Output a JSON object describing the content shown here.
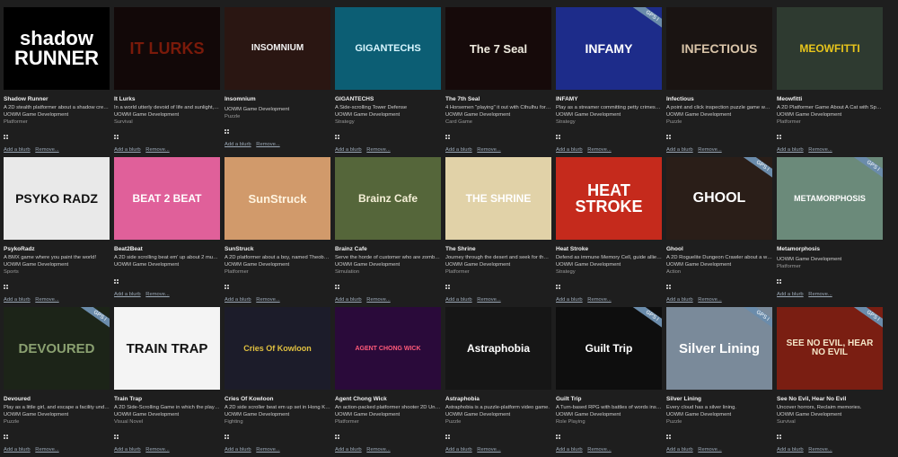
{
  "colors": {
    "background": "#1e1e1e",
    "action_link": "#9aa7b5",
    "ribbon": "#6b8cab"
  },
  "actions": {
    "add_blurb": "Add a blurb",
    "remove": "Remove..."
  },
  "games": [
    {
      "thumb_text": "shadow RUNNER",
      "title": "Shadow Runner",
      "blurb": "A 2D stealth platformer about a shadow creat...",
      "developer": "UOWM Game Development",
      "genre": "Platformer",
      "ribbon": "",
      "bg": "#000000",
      "fg": "#ffffff",
      "font": "22px"
    },
    {
      "thumb_text": "IT LURKS",
      "title": "It Lurks",
      "blurb": "In a world utterly devoid of life and sunlight, y...",
      "developer": "UOWM Game Development",
      "genre": "Survival",
      "ribbon": "",
      "bg": "#120808",
      "fg": "#7a1a0a",
      "font": "18px"
    },
    {
      "thumb_text": "INSOMNIUM",
      "title": "Insomnium",
      "blurb": "",
      "developer": "UOWM Game Development",
      "genre": "Puzzle",
      "ribbon": "",
      "bg": "#2a1612",
      "fg": "#f2f2f2",
      "font": "10px"
    },
    {
      "thumb_text": "GIGANTECHS",
      "title": "GIGANTECHS",
      "blurb": "A Side-scrolling Tower Defense",
      "developer": "UOWM Game Development",
      "genre": "Strategy",
      "ribbon": "",
      "bg": "#0c5e74",
      "fg": "#d8f6ff",
      "font": "11px"
    },
    {
      "thumb_text": "The 7 Seal",
      "title": "The 7th Seal",
      "blurb": "4 Horsemen \"playing\" it out with Cthulhu for t...",
      "developer": "UOWM Game Development",
      "genre": "Card Game",
      "ribbon": "",
      "bg": "#160a0a",
      "fg": "#f0ece0",
      "font": "13px"
    },
    {
      "thumb_text": "INFAMY",
      "title": "INFAMY",
      "blurb": "Play as a streamer committing petty crimes for...",
      "developer": "UOWM Game Development",
      "genre": "Strategy",
      "ribbon": "GPS I",
      "bg": "#1d2c8a",
      "fg": "#ffffff",
      "font": "14px"
    },
    {
      "thumb_text": "INFECTIOUS",
      "title": "Infectious",
      "blurb": "A point and click inspection puzzle game wher...",
      "developer": "UOWM Game Development",
      "genre": "Puzzle",
      "ribbon": "",
      "bg": "#1a1412",
      "fg": "#d9c4a8",
      "font": "14px"
    },
    {
      "thumb_text": "MEOWFITTI",
      "title": "Meowfitti",
      "blurb": "A 2D Platformer Game About A Cat with Spra...",
      "developer": "UOWM Game Development",
      "genre": "Platformer",
      "ribbon": "",
      "bg": "#2e3a30",
      "fg": "#e8c51c",
      "font": "12px"
    },
    {
      "thumb_text": "PSYKO RADZ",
      "title": "PsykoRadz",
      "blurb": "A BMX game where you paint the world!",
      "developer": "UOWM Game Development",
      "genre": "Sports",
      "ribbon": "",
      "bg": "#e9e9e9",
      "fg": "#111111",
      "font": "14px"
    },
    {
      "thumb_text": "BEAT 2 BEAT",
      "title": "Beat2Beat",
      "blurb": "A 2D side scrolling beat em' up about 2 musici...",
      "developer": "UOWM Game Development",
      "genre": "",
      "ribbon": "",
      "bg": "#e0609a",
      "fg": "#ffffff",
      "font": "12px"
    },
    {
      "thumb_text": "SunStruck",
      "title": "SunStruck",
      "blurb": "A 2D platformer about a boy, named Theoby, t...",
      "developer": "UOWM Game Development",
      "genre": "Platformer",
      "ribbon": "",
      "bg": "#d19a6b",
      "fg": "#fff4e0",
      "font": "13px"
    },
    {
      "thumb_text": "Brainz Cafe",
      "title": "Brainz Cafe",
      "blurb": "Serve the horde of customer who are zombie r...",
      "developer": "UOWM Game Development",
      "genre": "Simulation",
      "ribbon": "",
      "bg": "#55663a",
      "fg": "#f6f0d8",
      "font": "12px"
    },
    {
      "thumb_text": "THE SHRINE",
      "title": "The Shrine",
      "blurb": "Journey through the desert and seek for the w...",
      "developer": "UOWM Game Development",
      "genre": "Platformer",
      "ribbon": "",
      "bg": "#e1d2a8",
      "fg": "#ffffff",
      "font": "12px"
    },
    {
      "thumb_text": "HEAT STROKE",
      "title": "Heat Stroke",
      "blurb": "Defend as immune Memory Cell, guide allies t...",
      "developer": "UOWM Game Development",
      "genre": "Strategy",
      "ribbon": "",
      "bg": "#c52a1c",
      "fg": "#ffffff",
      "font": "18px"
    },
    {
      "thumb_text": "GHOOL",
      "title": "Ghool",
      "blurb": "A 2D Roguelite Dungeon Crawler about a war ...",
      "developer": "UOWM Game Development",
      "genre": "Action",
      "ribbon": "GPS I",
      "bg": "#2a1e18",
      "fg": "#ffffff",
      "font": "16px"
    },
    {
      "thumb_text": "METAMORPHOSIS",
      "title": "Metamorphosis",
      "blurb": "",
      "developer": "UOWM Game Development",
      "genre": "Platformer",
      "ribbon": "GPS I",
      "bg": "#6b8a7a",
      "fg": "#ffffff",
      "font": "9px"
    },
    {
      "thumb_text": "DEVOURED",
      "title": "Devoured",
      "blurb": "Play as a little girl, and escape a facility under a...",
      "developer": "UOWM Game Development",
      "genre": "Puzzle",
      "ribbon": "GPS I",
      "bg": "#1c2418",
      "fg": "#8aa070",
      "font": "15px"
    },
    {
      "thumb_text": "TRAIN TRAP",
      "title": "Train Trap",
      "blurb": "A 2D Side-Scrolling Game in which the player ...",
      "developer": "UOWM Game Development",
      "genre": "Visual Novel",
      "ribbon": "",
      "bg": "#f4f4f4",
      "fg": "#111111",
      "font": "15px"
    },
    {
      "thumb_text": "Cries Of Kowloon",
      "title": "Cries Of Kowloon",
      "blurb": "A 2D side scroller beat em up set in Hong Kong",
      "developer": "UOWM Game Development",
      "genre": "Fighting",
      "ribbon": "",
      "bg": "#1c1c2a",
      "fg": "#e0c040",
      "font": "9px"
    },
    {
      "thumb_text": "AGENT CHONG WICK",
      "title": "Agent Chong Wick",
      "blurb": "An action-packed platformer shooter 2D Unit...",
      "developer": "UOWM Game Development",
      "genre": "Platformer",
      "ribbon": "",
      "bg": "#2a0a3a",
      "fg": "#ff5a7a",
      "font": "7px"
    },
    {
      "thumb_text": "Astraphobia",
      "title": "Astraphobia",
      "blurb": "Astraphobia is a puzzle-platform video game.",
      "developer": "UOWM Game Development",
      "genre": "Puzzle",
      "ribbon": "",
      "bg": "#161616",
      "fg": "#ffffff",
      "font": "12px"
    },
    {
      "thumb_text": "Guilt Trip",
      "title": "Guilt Trip",
      "blurb": "A Turn-based RPG with battles of words inste...",
      "developer": "UOWM Game Development",
      "genre": "Role Playing",
      "ribbon": "GPS I",
      "bg": "#0e0e0e",
      "fg": "#ffffff",
      "font": "12px"
    },
    {
      "thumb_text": "Silver Lining",
      "title": "Silver Lining",
      "blurb": "Every cloud has a silver lining.",
      "developer": "UOWM Game Development",
      "genre": "Puzzle",
      "ribbon": "GPS I",
      "bg": "#7a8a9a",
      "fg": "#ffffff",
      "font": "15px"
    },
    {
      "thumb_text": "SEE NO EVIL, HEAR NO EVIL",
      "title": "See No Evil, Hear No Evil",
      "blurb": "Uncover horrors, Reclaim memories.",
      "developer": "UOWM Game Development",
      "genre": "Survival",
      "ribbon": "GPS I",
      "bg": "#7a1e12",
      "fg": "#f4e6c8",
      "font": "10px"
    }
  ]
}
